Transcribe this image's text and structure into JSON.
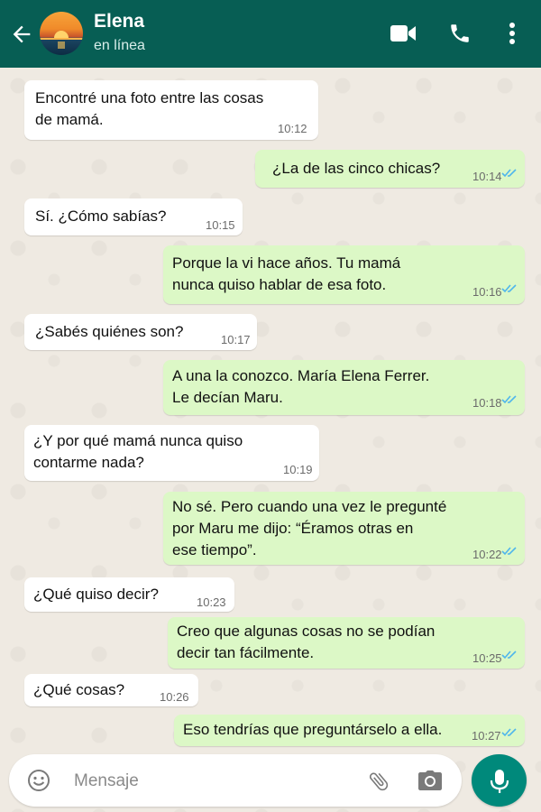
{
  "header": {
    "contact_name": "Elena",
    "status": "en línea",
    "colors": {
      "bar": "#075e54",
      "mic": "#00897b",
      "outgoing_bubble": "#dcf8c6",
      "read_ticks": "#4fb6ec"
    }
  },
  "messages": [
    {
      "dir": "in",
      "text": "Encontré una foto entre las cosas\nde mamá.",
      "time": "10:12"
    },
    {
      "dir": "out",
      "text": "¿La de las cinco chicas?",
      "time": "10:14",
      "read": true
    },
    {
      "dir": "in",
      "text": "Sí. ¿Cómo sabías?",
      "time": "10:15"
    },
    {
      "dir": "out",
      "text": "Porque la vi hace años. Tu mamá\nnunca quiso hablar de esa foto.",
      "time": "10:16",
      "read": true
    },
    {
      "dir": "in",
      "text": "¿Sabés quiénes son?",
      "time": "10:17"
    },
    {
      "dir": "out",
      "text": "A una la conozco. María Elena Ferrer.\nLe decían Maru.",
      "time": "10:18",
      "read": true
    },
    {
      "dir": "in",
      "text": "¿Y por qué mamá nunca quiso\ncontarme nada?",
      "time": "10:19"
    },
    {
      "dir": "out",
      "text": "No sé. Pero cuando una vez le pregunté\npor Maru me dijo: “Éramos otras en\nese tiempo”.",
      "time": "10:22",
      "read": true
    },
    {
      "dir": "in",
      "text": "¿Qué quiso decir?",
      "time": "10:23"
    },
    {
      "dir": "out",
      "text": "Creo que algunas cosas no se podían\ndecir tan fácilmente.",
      "time": "10:25",
      "read": true
    },
    {
      "dir": "in",
      "text": "¿Qué cosas?",
      "time": "10:26"
    },
    {
      "dir": "out",
      "text": "Eso tendrías que preguntárselo a ella.",
      "time": "10:27",
      "read": true
    }
  ],
  "composer": {
    "placeholder": "Mensaje",
    "icons": [
      "emoji-icon",
      "attach-icon",
      "camera-icon",
      "mic-icon"
    ]
  }
}
